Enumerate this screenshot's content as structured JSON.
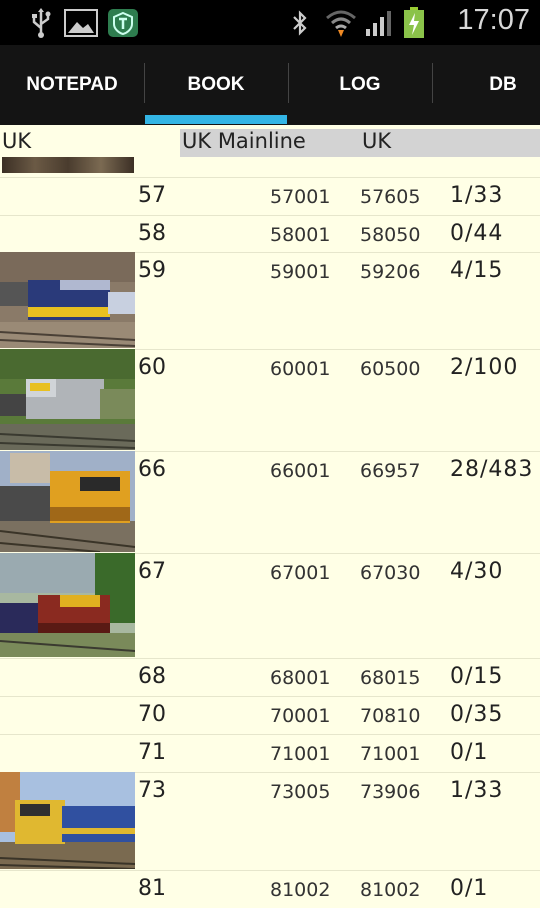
{
  "status_bar": {
    "time": "17:07",
    "icons": [
      "usb-icon",
      "image-icon",
      "shield-app-icon",
      "bluetooth-icon",
      "wifi-icon",
      "signal-icon",
      "battery-charging-icon"
    ]
  },
  "tabs": [
    {
      "label": "NOTEPAD",
      "selected": false
    },
    {
      "label": "BOOK",
      "selected": true
    },
    {
      "label": "LOG",
      "selected": false
    },
    {
      "label": "DB",
      "selected": false
    }
  ],
  "header": {
    "region": "UK",
    "line": "UK Mainline",
    "country": "UK"
  },
  "rows": [
    {
      "class": "57",
      "from": "57001",
      "to": "57605",
      "count": "1/33",
      "photo": null
    },
    {
      "class": "58",
      "from": "58001",
      "to": "58050",
      "count": "0/44",
      "photo": null
    },
    {
      "class": "59",
      "from": "59001",
      "to": "59206",
      "count": "4/15",
      "photo": "locomotive-photo"
    },
    {
      "class": "60",
      "from": "60001",
      "to": "60500",
      "count": "2/100",
      "photo": "locomotive-photo"
    },
    {
      "class": "66",
      "from": "66001",
      "to": "66957",
      "count": "28/483",
      "photo": "locomotive-photo"
    },
    {
      "class": "67",
      "from": "67001",
      "to": "67030",
      "count": "4/30",
      "photo": "locomotive-photo"
    },
    {
      "class": "68",
      "from": "68001",
      "to": "68015",
      "count": "0/15",
      "photo": null
    },
    {
      "class": "70",
      "from": "70001",
      "to": "70810",
      "count": "0/35",
      "photo": null
    },
    {
      "class": "71",
      "from": "71001",
      "to": "71001",
      "count": "0/1",
      "photo": null
    },
    {
      "class": "73",
      "from": "73005",
      "to": "73906",
      "count": "1/33",
      "photo": "locomotive-photo"
    },
    {
      "class": "81",
      "from": "81002",
      "to": "81002",
      "count": "0/1",
      "photo": null
    }
  ]
}
